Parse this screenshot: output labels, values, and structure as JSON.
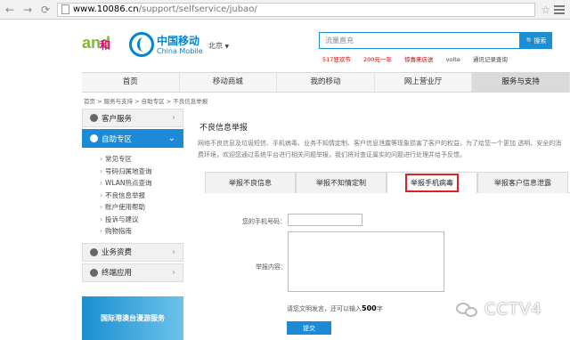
{
  "browser": {
    "url_host": "www.10086.cn",
    "url_path": "/support/selfservice/jubao/"
  },
  "header": {
    "logo_and": "and",
    "logo_he": "和",
    "brand_cn": "中国移动",
    "brand_en": "China Mobile",
    "city": "北京",
    "search_placeholder": "流量直充",
    "search_button": "搜索",
    "hot_links": [
      "517狂欢节",
      "200元一年",
      "惊喜来店送",
      "volte",
      "通讯记录查询"
    ]
  },
  "main_nav": [
    "首页",
    "移动商城",
    "我的移动",
    "网上营业厅",
    "服务与支持"
  ],
  "breadcrumb": "首页 > 服务与支持 > 自助专区 > 不良信息举报",
  "sidebar": {
    "customer_service": "客户服务",
    "self_service": "自助专区",
    "self_items": [
      "常见专区",
      "号码归属地查询",
      "WLAN热点查询",
      "不良信息举报",
      "账户使用帮助",
      "投诉与建议",
      "购物指南"
    ],
    "fees": "业务资费",
    "terminal": "终端应用",
    "banner": "国际港澳台漫游服务"
  },
  "content": {
    "title": "不良信息举报",
    "description": "网络不良信息及垃圾短信、手机病毒、业务不知情定制、客户信息泄露等现象损害了客户的权益，为了给您一个更加 透明、安全的消费环境，欢迎您通过系统平台进行相关问题举报，我们将对查证属实的问题进行处理并给予反馈。",
    "tabs": [
      "举报不良信息",
      "举报不知情定制",
      "举报手机病毒",
      "举报客户信息泄露"
    ],
    "active_tab": 2,
    "phone_label": "您的手机号码：",
    "content_label": "举报内容：",
    "hint_prefix": "请您文明发言，还可以输入",
    "hint_count": "500",
    "hint_suffix": "字",
    "submit": "提交"
  },
  "watermark": "CCTV4"
}
